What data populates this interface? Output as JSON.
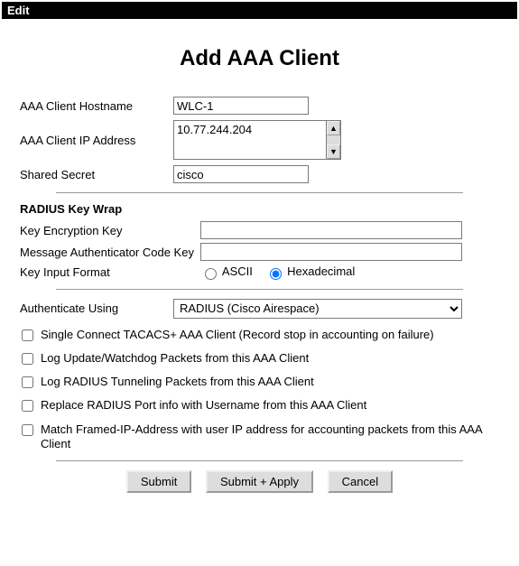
{
  "window": {
    "menu_edit": "Edit"
  },
  "title": "Add AAA Client",
  "labels": {
    "hostname": "AAA Client Hostname",
    "ip": "AAA Client IP Address",
    "secret": "Shared Secret",
    "keywrap_section": "RADIUS Key Wrap",
    "kek": "Key Encryption Key",
    "mack": "Message Authenticator Code Key",
    "kif": "Key Input Format",
    "auth_using": "Authenticate Using"
  },
  "fields": {
    "hostname": "WLC-1",
    "ip": "10.77.244.204",
    "secret": "cisco",
    "kek": "",
    "mack": ""
  },
  "key_input_format": {
    "ascii_label": "ASCII",
    "hex_label": "Hexadecimal",
    "selected": "Hexadecimal"
  },
  "auth": {
    "selected": "RADIUS (Cisco Airespace)"
  },
  "checkboxes": [
    {
      "label": "Single Connect TACACS+ AAA Client (Record stop in accounting on failure)",
      "checked": false
    },
    {
      "label": "Log Update/Watchdog Packets from this AAA Client",
      "checked": false
    },
    {
      "label": "Log RADIUS Tunneling Packets from this AAA Client",
      "checked": false
    },
    {
      "label": "Replace RADIUS Port info with Username from this AAA Client",
      "checked": false
    },
    {
      "label": "Match Framed-IP-Address with user IP address for accounting packets from this AAA Client",
      "checked": false
    }
  ],
  "buttons": {
    "submit": "Submit",
    "submit_apply": "Submit + Apply",
    "cancel": "Cancel"
  }
}
